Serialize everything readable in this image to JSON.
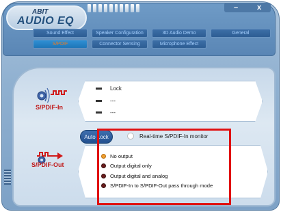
{
  "app": {
    "logo_top": "ABIT",
    "logo_main": "AUDIO EQ",
    "window_controls": {
      "minimize": "–",
      "close": "x"
    }
  },
  "tabs": {
    "sound_effect": "Sound Effect",
    "speaker_configuration": "Speaker Configuration",
    "audio_3d_demo": "3D Audio Demo",
    "general": "General",
    "spdif": "S/PDIF",
    "connector_sensing": "Connector Sensing",
    "microphone_effect": "Microphone Effect"
  },
  "spdif_in": {
    "label": "S/PDIF-In",
    "lock_rows": [
      "Lock",
      "---",
      "---"
    ]
  },
  "spdif_out": {
    "label": "S/PDIF-Out",
    "auto_lock_button": "Auto Lock",
    "monitor_label": "Real-time S/PDIF-In monitor",
    "options": [
      {
        "label": "No output",
        "selected": true
      },
      {
        "label": "Output digital only",
        "selected": false
      },
      {
        "label": "Output digital and analog",
        "selected": false
      },
      {
        "label": "S/PDIF-In to S/PDIF-Out pass through mode",
        "selected": false
      }
    ]
  },
  "colors": {
    "accent_active_tab_text": "#f07a1e",
    "tab_text": "#a6d0ff",
    "device_label": "#c01818",
    "highlight_box": "#e01010"
  }
}
